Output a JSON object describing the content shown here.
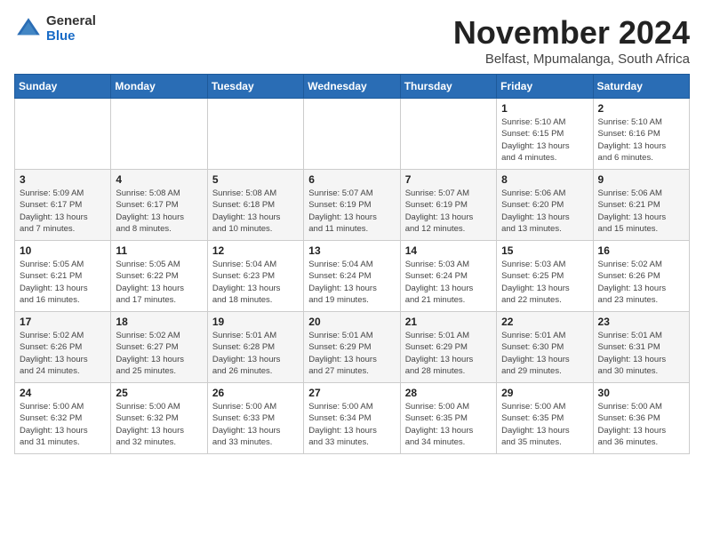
{
  "logo": {
    "general": "General",
    "blue": "Blue"
  },
  "header": {
    "month_year": "November 2024",
    "location": "Belfast, Mpumalanga, South Africa"
  },
  "weekdays": [
    "Sunday",
    "Monday",
    "Tuesday",
    "Wednesday",
    "Thursday",
    "Friday",
    "Saturday"
  ],
  "weeks": [
    [
      {
        "day": "",
        "info": ""
      },
      {
        "day": "",
        "info": ""
      },
      {
        "day": "",
        "info": ""
      },
      {
        "day": "",
        "info": ""
      },
      {
        "day": "",
        "info": ""
      },
      {
        "day": "1",
        "info": "Sunrise: 5:10 AM\nSunset: 6:15 PM\nDaylight: 13 hours\nand 4 minutes."
      },
      {
        "day": "2",
        "info": "Sunrise: 5:10 AM\nSunset: 6:16 PM\nDaylight: 13 hours\nand 6 minutes."
      }
    ],
    [
      {
        "day": "3",
        "info": "Sunrise: 5:09 AM\nSunset: 6:17 PM\nDaylight: 13 hours\nand 7 minutes."
      },
      {
        "day": "4",
        "info": "Sunrise: 5:08 AM\nSunset: 6:17 PM\nDaylight: 13 hours\nand 8 minutes."
      },
      {
        "day": "5",
        "info": "Sunrise: 5:08 AM\nSunset: 6:18 PM\nDaylight: 13 hours\nand 10 minutes."
      },
      {
        "day": "6",
        "info": "Sunrise: 5:07 AM\nSunset: 6:19 PM\nDaylight: 13 hours\nand 11 minutes."
      },
      {
        "day": "7",
        "info": "Sunrise: 5:07 AM\nSunset: 6:19 PM\nDaylight: 13 hours\nand 12 minutes."
      },
      {
        "day": "8",
        "info": "Sunrise: 5:06 AM\nSunset: 6:20 PM\nDaylight: 13 hours\nand 13 minutes."
      },
      {
        "day": "9",
        "info": "Sunrise: 5:06 AM\nSunset: 6:21 PM\nDaylight: 13 hours\nand 15 minutes."
      }
    ],
    [
      {
        "day": "10",
        "info": "Sunrise: 5:05 AM\nSunset: 6:21 PM\nDaylight: 13 hours\nand 16 minutes."
      },
      {
        "day": "11",
        "info": "Sunrise: 5:05 AM\nSunset: 6:22 PM\nDaylight: 13 hours\nand 17 minutes."
      },
      {
        "day": "12",
        "info": "Sunrise: 5:04 AM\nSunset: 6:23 PM\nDaylight: 13 hours\nand 18 minutes."
      },
      {
        "day": "13",
        "info": "Sunrise: 5:04 AM\nSunset: 6:24 PM\nDaylight: 13 hours\nand 19 minutes."
      },
      {
        "day": "14",
        "info": "Sunrise: 5:03 AM\nSunset: 6:24 PM\nDaylight: 13 hours\nand 21 minutes."
      },
      {
        "day": "15",
        "info": "Sunrise: 5:03 AM\nSunset: 6:25 PM\nDaylight: 13 hours\nand 22 minutes."
      },
      {
        "day": "16",
        "info": "Sunrise: 5:02 AM\nSunset: 6:26 PM\nDaylight: 13 hours\nand 23 minutes."
      }
    ],
    [
      {
        "day": "17",
        "info": "Sunrise: 5:02 AM\nSunset: 6:26 PM\nDaylight: 13 hours\nand 24 minutes."
      },
      {
        "day": "18",
        "info": "Sunrise: 5:02 AM\nSunset: 6:27 PM\nDaylight: 13 hours\nand 25 minutes."
      },
      {
        "day": "19",
        "info": "Sunrise: 5:01 AM\nSunset: 6:28 PM\nDaylight: 13 hours\nand 26 minutes."
      },
      {
        "day": "20",
        "info": "Sunrise: 5:01 AM\nSunset: 6:29 PM\nDaylight: 13 hours\nand 27 minutes."
      },
      {
        "day": "21",
        "info": "Sunrise: 5:01 AM\nSunset: 6:29 PM\nDaylight: 13 hours\nand 28 minutes."
      },
      {
        "day": "22",
        "info": "Sunrise: 5:01 AM\nSunset: 6:30 PM\nDaylight: 13 hours\nand 29 minutes."
      },
      {
        "day": "23",
        "info": "Sunrise: 5:01 AM\nSunset: 6:31 PM\nDaylight: 13 hours\nand 30 minutes."
      }
    ],
    [
      {
        "day": "24",
        "info": "Sunrise: 5:00 AM\nSunset: 6:32 PM\nDaylight: 13 hours\nand 31 minutes."
      },
      {
        "day": "25",
        "info": "Sunrise: 5:00 AM\nSunset: 6:32 PM\nDaylight: 13 hours\nand 32 minutes."
      },
      {
        "day": "26",
        "info": "Sunrise: 5:00 AM\nSunset: 6:33 PM\nDaylight: 13 hours\nand 33 minutes."
      },
      {
        "day": "27",
        "info": "Sunrise: 5:00 AM\nSunset: 6:34 PM\nDaylight: 13 hours\nand 33 minutes."
      },
      {
        "day": "28",
        "info": "Sunrise: 5:00 AM\nSunset: 6:35 PM\nDaylight: 13 hours\nand 34 minutes."
      },
      {
        "day": "29",
        "info": "Sunrise: 5:00 AM\nSunset: 6:35 PM\nDaylight: 13 hours\nand 35 minutes."
      },
      {
        "day": "30",
        "info": "Sunrise: 5:00 AM\nSunset: 6:36 PM\nDaylight: 13 hours\nand 36 minutes."
      }
    ]
  ]
}
